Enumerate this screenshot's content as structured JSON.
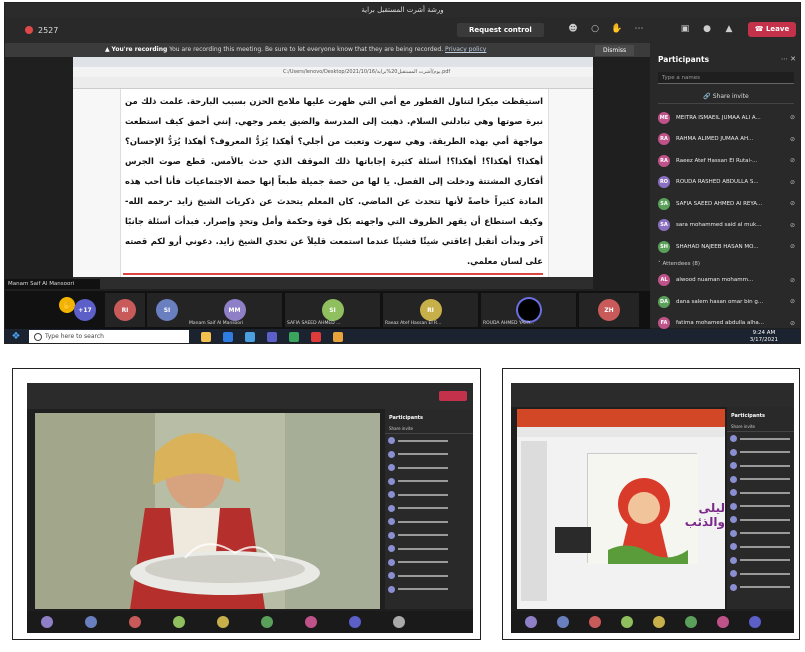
{
  "main": {
    "window_title": "ورشة أشرت المستقبل براية",
    "timer": "2527",
    "request_control": "Request control",
    "leave": "Leave",
    "rec_banner": {
      "title": "You're recording",
      "body": "You are recording this meeting. Be sure to let everyone know that they are being recorded.",
      "link": "Privacy policy",
      "dismiss": "Dismiss"
    },
    "doc_path": "C:/Users/lenovo/Desktop/2021/10/16/يوم/أشرت المستقبل20%براية.pdf",
    "doc_text": "استيقظت ميكرا لتناول الفطور مع أمي التي ظهرت عليها ملامح الحزن بسبب البارحة. علمت ذلك من نبرة صوتها وهي تبادلني السلام. ذهبت إلى المدرسة والضيق يغمر وجهي. إنني أحمق كيف استطعت مواجهة أمي بهذه الطريقة. وهي سهرت وتعبت من أجلي؟ أهكذا يُرَدُّ المعروف؟ أهكذا يُرَدُّ الإحسان؟ أهكذا؟ أهكذا؟! أهكذا؟! أسئلة كثيرة إجاباتها ذلك الموقف الذي حدث بالأمس. قطع صوت الجرس أفكاري المشتتة ودخلت إلى الفصل. يا لها من حصة جميلة طبعاً إنها حصة الاجتماعيات فأنا أحب هذه المادة كثيراً خاصةً لأنها تتحدث عن الماضي. كان المعلم يتحدث عن ذكريات الشيخ زايد -رحمه الله- وكيف استطاع أن يقهر الظروف التي واجهته بكل قوة وحكمة وأمل وتحدٍ وإصرار. فبدأت أسئلة جانبًا آخر وبدأت أتقبل إعاقتي شيئًا فشيئًا عندما استمعت قليلاً عن تحدي الشيخ زايد. دعوني أرو لكم قصته على لسان معلمي.",
    "presenter_label": "Manam Saif Al Mansoori",
    "participants_title": "Participants",
    "search_placeholder": "Type a names",
    "share_invite": "Share invite",
    "participants": [
      {
        "initials": "ME",
        "name": "MEITRA ISMAEIL JUMAA ALI A...",
        "color": "#c0528a"
      },
      {
        "initials": "RA",
        "name": "RAHMA ALIMED JUMAA AH...",
        "color": "#c0528a"
      },
      {
        "initials": "RA",
        "name": "Raeez Atef Hassan El Rutai-...",
        "color": "#c0528a"
      },
      {
        "initials": "RO",
        "name": "ROUDA RASHED ABDULLA S...",
        "color": "#8a6fc0"
      },
      {
        "initials": "SA",
        "name": "SAFIA SAEED AHMED Al REYA...",
        "color": "#5aa05a"
      },
      {
        "initials": "SA",
        "name": "sara mohammed said al muk...",
        "color": "#8a6fc0"
      },
      {
        "initials": "SH",
        "name": "SHAHAD NAJEEB HASAN MO...",
        "color": "#5aa05a"
      }
    ],
    "attendees_label": "Attendees (8)",
    "attendees": [
      {
        "initials": "AL",
        "name": "alwood nuaman mohamm...",
        "color": "#c0528a"
      },
      {
        "initials": "DA",
        "name": "dana salem hasan omar bin g...",
        "color": "#5aa05a"
      },
      {
        "initials": "FA",
        "name": "fatima mohamed abdulla alha...",
        "color": "#c0528a"
      }
    ],
    "tiles": [
      {
        "initials": "+17",
        "label": "",
        "color": "#5b5fc7"
      },
      {
        "initials": "RI",
        "label": "",
        "color": "#c95a5a"
      },
      {
        "initials": "SI",
        "label": "",
        "color": "#6a7fbf"
      },
      {
        "initials": "MM",
        "label": "Manam Saif Al Mansoori",
        "color": "#8f7fc7"
      },
      {
        "initials": "SI",
        "label": "SAFIA SAEED AHMED ...",
        "color": "#8fbf5f"
      },
      {
        "initials": "RI",
        "label": "Raeaz Atef Hassan El R...",
        "color": "#c7b04a"
      },
      {
        "initials": "",
        "label": "ROUDA AHMED YAHY...",
        "color": "#000000"
      },
      {
        "initials": "ZH",
        "label": "",
        "color": "#c95a5a"
      }
    ],
    "taskbar_search": "Type here to search",
    "clock_time": "9:24 AM",
    "clock_date": "3/17/2021"
  },
  "bottom_left": {
    "participants_title": "Participants",
    "share_invite": "Share invite"
  },
  "bottom_right": {
    "participants_title": "Participants",
    "share_invite": "Share invite",
    "slide_title": "ليلى والذئب"
  }
}
